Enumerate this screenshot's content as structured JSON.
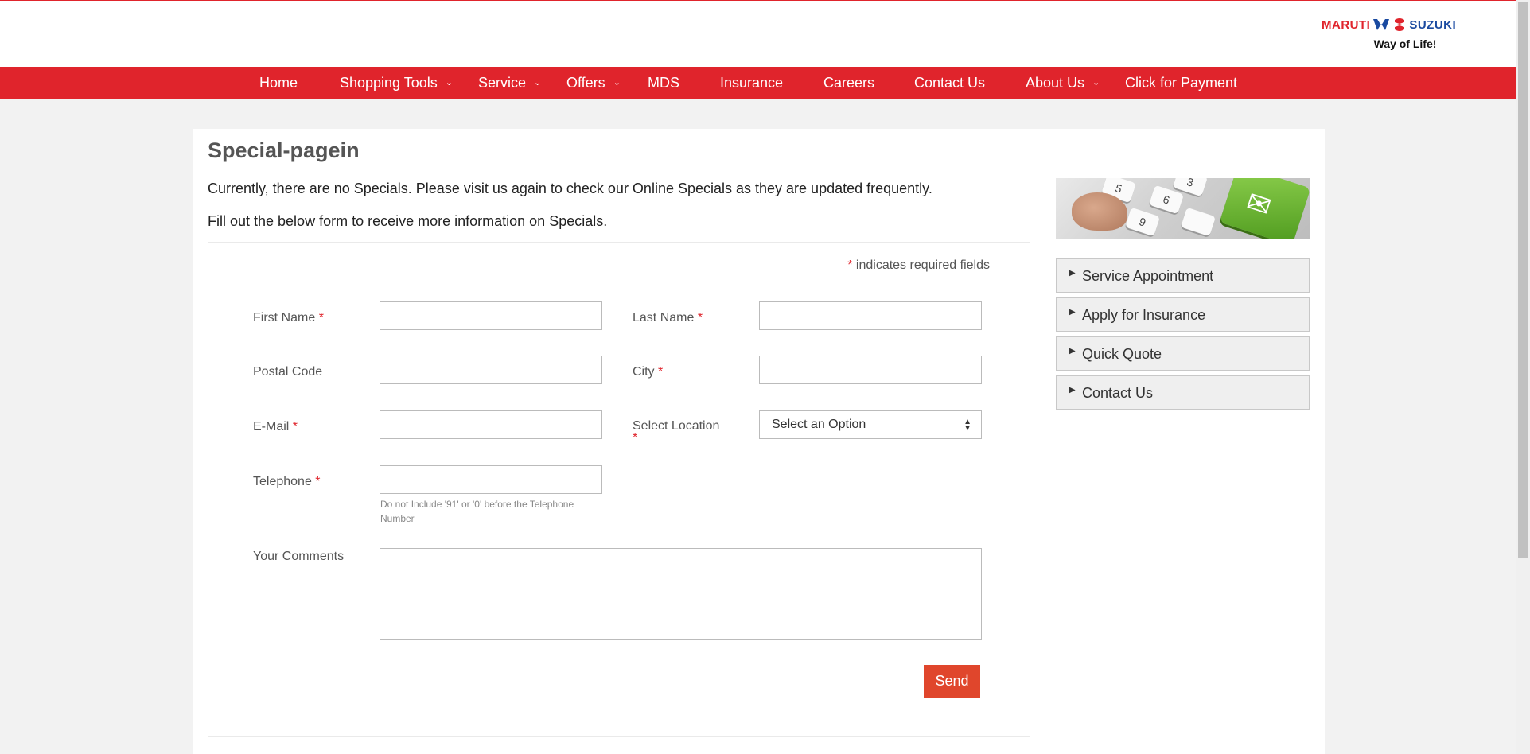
{
  "logo": {
    "left": "MARUTI",
    "right": "SUZUKI",
    "tagline": "Way of Life!"
  },
  "nav": {
    "items": [
      {
        "label": "Home"
      },
      {
        "label": "Shopping Tools"
      },
      {
        "label": "Service"
      },
      {
        "label": "Offers"
      },
      {
        "label": "MDS"
      },
      {
        "label": "Insurance"
      },
      {
        "label": "Careers"
      },
      {
        "label": "Contact Us"
      },
      {
        "label": "About Us"
      },
      {
        "label": "Click for Payment"
      }
    ],
    "chevron_icon": "chevron-down-icon"
  },
  "page": {
    "title": "Special-pagein",
    "intro1": "Currently, there are no Specials. Please visit us again to check our Online Specials as they are updated frequently.",
    "intro2": "Fill out the below form to receive more information on Specials."
  },
  "form": {
    "required_star": "*",
    "required_note": "indicates required fields",
    "first_name_label": "First Name",
    "last_name_label": "Last Name",
    "postal_code_label": "Postal Code",
    "city_label": "City",
    "email_label": "E-Mail",
    "select_location_label": "Select Location",
    "select_location_value": "Select an Option",
    "telephone_label": "Telephone",
    "telephone_hint": "Do not Include '91' or '0' before the Telephone Number",
    "comments_label": "Your Comments",
    "send_label": "Send"
  },
  "sidebar": {
    "banner_icon": "envelope-key-icon",
    "links": [
      {
        "label": "Service Appointment"
      },
      {
        "label": "Apply for Insurance"
      },
      {
        "label": "Quick Quote"
      },
      {
        "label": "Contact Us"
      }
    ]
  },
  "colors": {
    "brand_red": "#e0242c",
    "send_button": "#e0462c",
    "suzuki_blue": "#1a4aa0"
  }
}
